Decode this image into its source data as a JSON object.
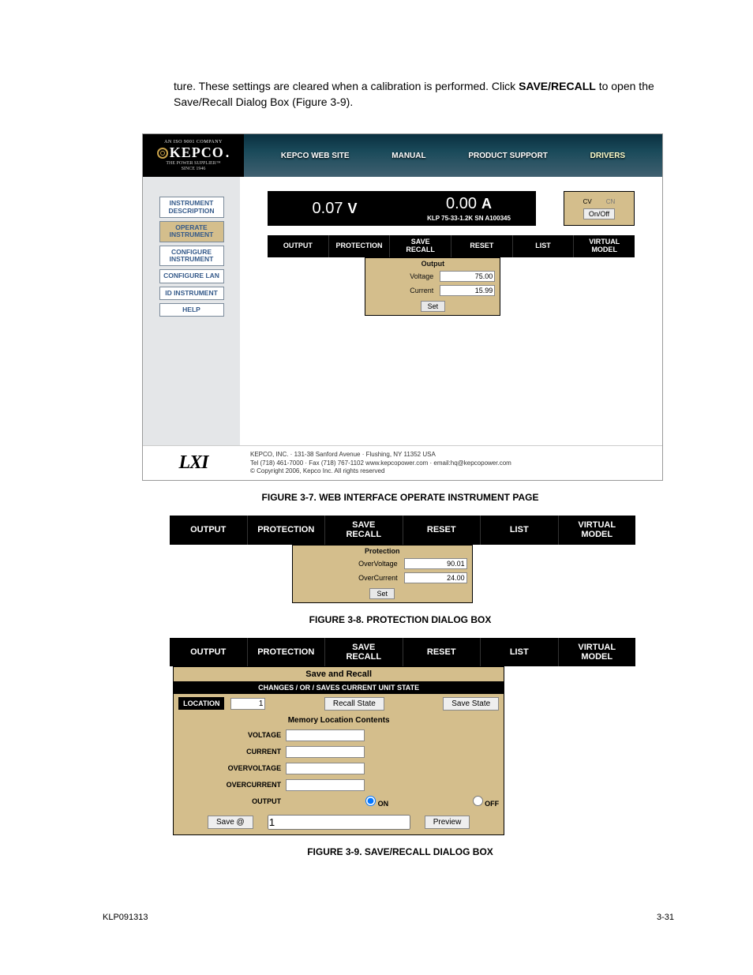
{
  "paragraph": {
    "pre": "ture. These settings are cleared when a calibration is performed. Click ",
    "bold": "SAVE/RECALL",
    "post": " to open the Save/Recall Dialog Box (Figure 3-9)."
  },
  "app": {
    "logo": {
      "top": "AN ISO 9001 COMPANY",
      "brand": "KEPCO",
      "sub1": "THE POWER SUPPLIER™",
      "sub2": "SINCE 1946"
    },
    "nav": [
      "KEPCO WEB SITE",
      "MANUAL",
      "PRODUCT SUPPORT",
      "DRIVERS"
    ],
    "sidebar": [
      "INSTRUMENT DESCRIPTION",
      "OPERATE INSTRUMENT",
      "CONFIGURE INSTRUMENT",
      "CONFIGURE LAN",
      "ID INSTRUMENT",
      "HELP"
    ],
    "sidebar_active_index": 1,
    "display": {
      "voltage": "0.07",
      "voltage_unit": "V",
      "current": "0.00",
      "current_unit": "A",
      "serial": "KLP 75-33-1.2K SN A100345",
      "mode1": "CV",
      "mode2": "CN",
      "onoff": "On/Off"
    },
    "tabs": [
      "OUTPUT",
      "PROTECTION",
      "SAVE\nRECALL",
      "RESET",
      "LIST",
      "VIRTUAL\nMODEL"
    ],
    "output_dialog": {
      "title": "Output",
      "voltage_label": "Voltage",
      "voltage_value": "75.00",
      "current_label": "Current",
      "current_value": "15.99",
      "set": "Set"
    },
    "footer_brand": "LXI",
    "footer_text": {
      "l1": "KEPCO, INC. · 131-38 Sanford Avenue · Flushing, NY 11352 USA",
      "l2": "Tel (718) 461-7000 · Fax (718) 767-1102 www.kepcopower.com · email:hq@kepcopower.com",
      "l3": "© Copyright 2006, Kepco Inc. All rights reserved"
    }
  },
  "captions": {
    "fig37": "FIGURE 3-7.    WEB INTERFACE OPERATE INSTRUMENT PAGE",
    "fig38": "FIGURE 3-8.    PROTECTION DIALOG BOX",
    "fig39": "FIGURE 3-9.    SAVE/RECALL DIALOG BOX"
  },
  "protection": {
    "title": "Protection",
    "ov_label": "OverVoltage",
    "ov_value": "90.01",
    "oc_label": "OverCurrent",
    "oc_value": "24.00",
    "set": "Set"
  },
  "save_recall": {
    "title": "Save and Recall",
    "subtitle": "CHANGES / OR / SAVES CURRENT UNIT STATE",
    "location_label": "LOCATION",
    "location_value": "1",
    "recall_btn": "Recall State",
    "save_btn": "Save State",
    "mem_title": "Memory Location Contents",
    "rows": {
      "voltage": "VOLTAGE",
      "current": "CURRENT",
      "overvoltage": "OVERVOLTAGE",
      "overcurrent": "OVERCURRENT",
      "output": "OUTPUT"
    },
    "on": "ON",
    "off": "OFF",
    "save_at": "Save @",
    "save_at_value": "1",
    "preview": "Preview"
  },
  "footer": {
    "doc": "KLP091313",
    "page": "3-31"
  }
}
